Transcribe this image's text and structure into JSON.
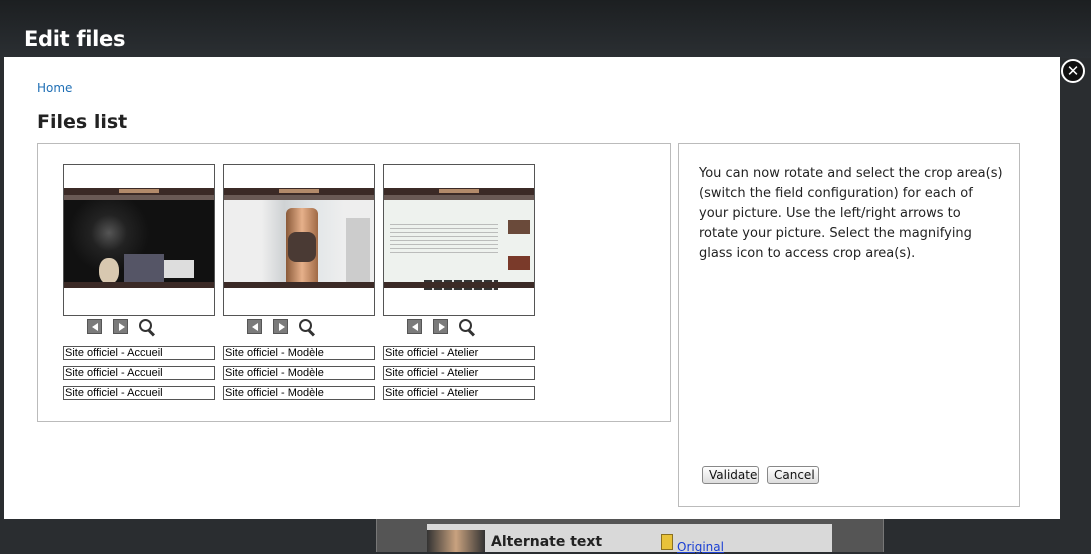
{
  "page": {
    "heading": "Edit files"
  },
  "modal": {
    "breadcrumb": "Home",
    "title": "Files list",
    "close_symbol": "✕",
    "files": [
      {
        "preview": "parmigiani-homepage-screenshot",
        "alt_texts": [
          "Site officiel - Accueil",
          "Site officiel - Accueil",
          "Site officiel - Accueil"
        ]
      },
      {
        "preview": "parmigiani-model-watch-screenshot",
        "alt_texts": [
          "Site officiel - Modèle",
          "Site officiel - Modèle",
          "Site officiel - Modèle"
        ]
      },
      {
        "preview": "parmigiani-atelier-screenshot",
        "alt_texts": [
          "Site officiel - Atelier",
          "Site officiel - Atelier",
          "Site officiel - Atelier"
        ]
      }
    ],
    "controls": {
      "left_icon": "arrow-left-icon",
      "right_icon": "arrow-right-icon",
      "zoom_icon": "magnifying-glass-icon"
    },
    "info_text": "You can now rotate and select the crop area(s) (switch the field configuration) for each of your picture. Use the left/right arrows to rotate your picture. Select the magnifying glass icon to access crop area(s).",
    "validate_label": "Validate",
    "cancel_label": "Cancel"
  },
  "underlay": {
    "label": "Alternate text",
    "link": "Original"
  },
  "colors": {
    "link": "#1f6fb5",
    "modal_bg": "#ffffff",
    "backdrop": "#2a2d30"
  }
}
